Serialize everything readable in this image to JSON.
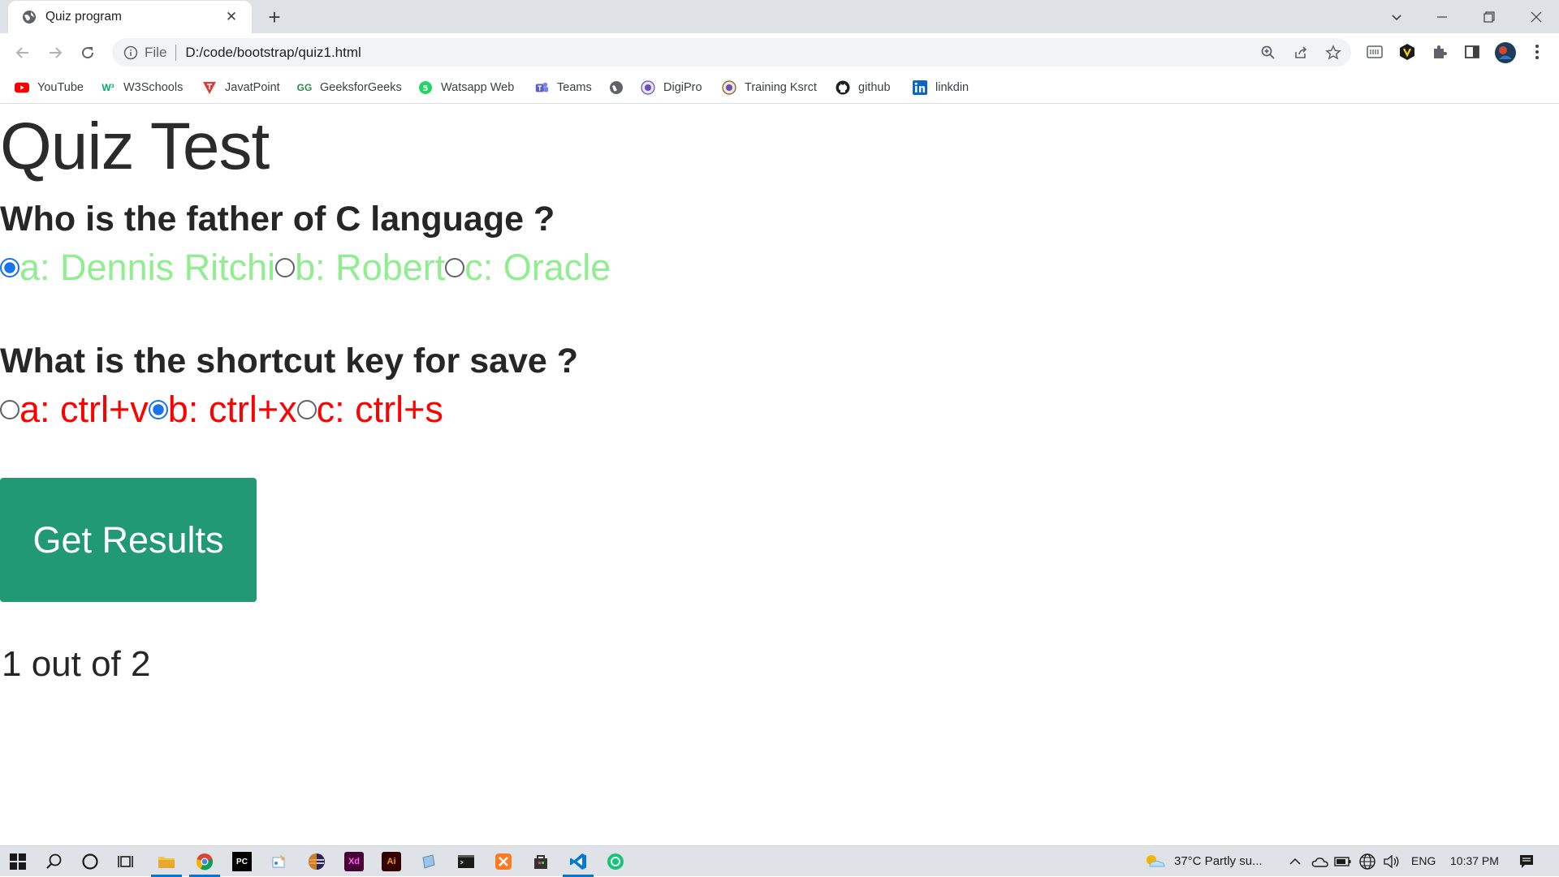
{
  "browser": {
    "tab_title": "Quiz program",
    "url_scheme": "File",
    "url": "D:/code/bootstrap/quiz1.html"
  },
  "bookmarks": [
    {
      "label": "YouTube",
      "icon": "youtube-icon",
      "color": "#ff0000"
    },
    {
      "label": "W3Schools",
      "icon": "w3schools-icon",
      "color": "#04aa6d"
    },
    {
      "label": "JavatPoint",
      "icon": "javatpoint-icon",
      "color": "#e53935"
    },
    {
      "label": "GeeksforGeeks",
      "icon": "geeksforgeeks-icon",
      "color": "#2f8d46"
    },
    {
      "label": "Watsapp Web",
      "icon": "whatsapp-icon",
      "color": "#25d366"
    },
    {
      "label": "Teams",
      "icon": "teams-icon",
      "color": "#5b5fc7"
    },
    {
      "label": "",
      "icon": "globe-icon",
      "color": "#5f6368"
    },
    {
      "label": "DigiPro",
      "icon": "digipro-icon",
      "color": "#6a4fb6"
    },
    {
      "label": "Training Ksrct",
      "icon": "ksrct-icon",
      "color": "#6a4fb6"
    },
    {
      "label": "github",
      "icon": "github-icon",
      "color": "#1b1f23"
    },
    {
      "label": "linkdin",
      "icon": "linkedin-icon",
      "color": "#0a66c2"
    }
  ],
  "page": {
    "heading": "Quiz Test",
    "questions": [
      {
        "text": "Who is the father of C language ?",
        "color": "#90ee90",
        "options": [
          {
            "label": "a: Dennis Ritchi",
            "checked": true
          },
          {
            "label": "b: Robert",
            "checked": false
          },
          {
            "label": "c: Oracle",
            "checked": false
          }
        ]
      },
      {
        "text": "What is the shortcut key for save ?",
        "color": "#ff0000",
        "options": [
          {
            "label": "a: ctrl+v",
            "checked": false
          },
          {
            "label": "b: ctrl+x",
            "checked": true
          },
          {
            "label": "c: ctrl+s",
            "checked": false
          }
        ]
      }
    ],
    "button_label": "Get Results",
    "button_color": "#219a73",
    "result": "1 out of 2"
  },
  "taskbar": {
    "weather": "37°C  Partly su...",
    "language": "ENG",
    "time": "10:37 PM"
  }
}
